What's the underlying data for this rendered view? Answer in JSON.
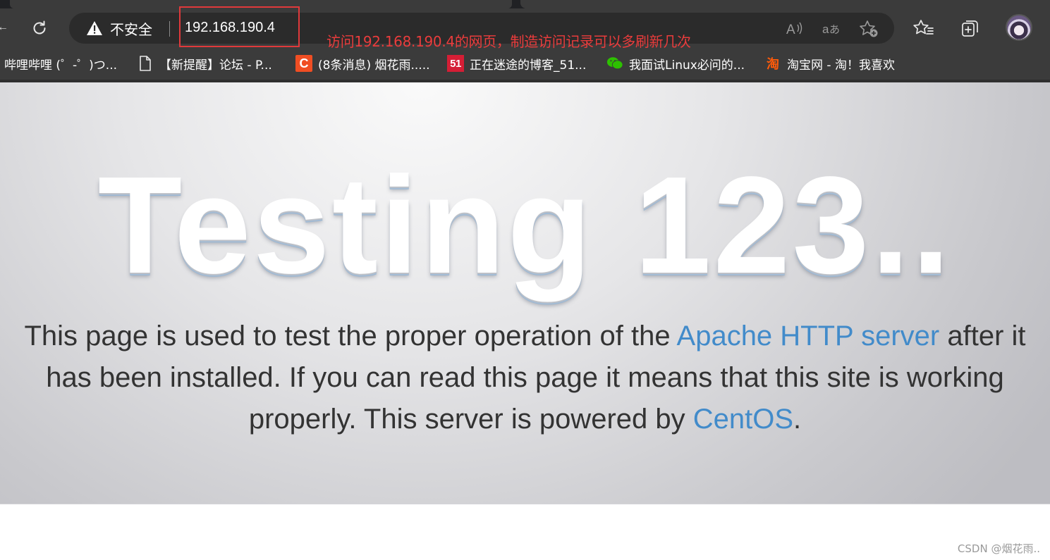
{
  "browser": {
    "security_label": "不安全",
    "url": "192.168.190.4",
    "icons": {
      "reload": "reload-icon",
      "warning": "warning-icon",
      "read_aloud": "read-aloud-icon",
      "translate": "translate-icon",
      "add_favorite": "add-favorite-icon",
      "favorites": "favorites-icon",
      "collections": "collections-icon",
      "profile": "avatar"
    }
  },
  "annotation": {
    "note": "访问192.168.190.4的网页，制造访问记录可以多刷新几次",
    "color": "#e0393b"
  },
  "bookmarks": [
    {
      "label": "哔哩哔哩 (゜-゜)つ...",
      "icon": "none"
    },
    {
      "label": "【新提醒】论坛 - P...",
      "icon": "page-icon"
    },
    {
      "label": "(8条消息) 烟花雨.....",
      "icon": "csdn-icon",
      "glyph": "C"
    },
    {
      "label": "正在迷途的博客_51...",
      "icon": "51cto-icon",
      "glyph": "51"
    },
    {
      "label": "我面试Linux必问的...",
      "icon": "wechat-icon"
    },
    {
      "label": "淘宝网 - 淘！我喜欢",
      "icon": "taobao-icon",
      "glyph": "淘"
    }
  ],
  "page": {
    "title": "Testing 123..",
    "para_before_link1": "This page is used to test the proper operation of the ",
    "link1": "Apache HTTP server",
    "para_middle": " after it has been installed. If you can read this page it means that this site is working properly. This server is powered by ",
    "link2": "CentOS",
    "para_end": ".",
    "link_color": "#428bca"
  },
  "watermark": "CSDN @烟花雨.."
}
